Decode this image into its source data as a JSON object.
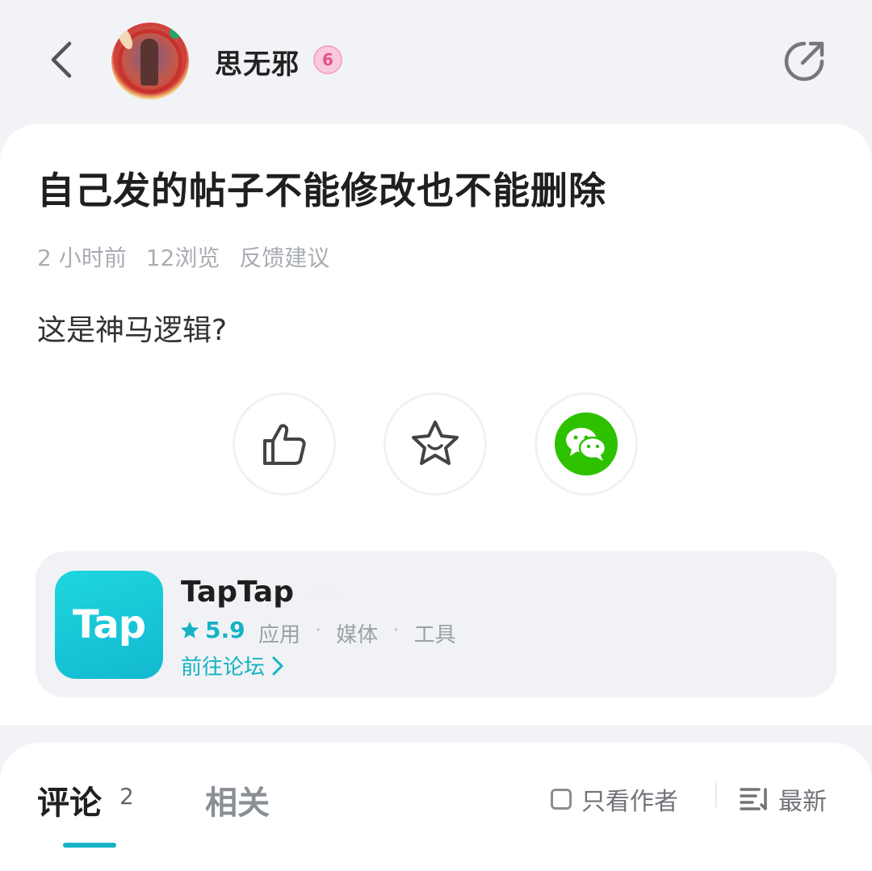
{
  "header": {
    "username": "思无邪",
    "level": "6"
  },
  "post": {
    "title": "自己发的帖子不能修改也不能删除",
    "time": "2 小时前",
    "views": "12浏览",
    "category": "反馈建议",
    "content": "这是神马逻辑?"
  },
  "app": {
    "icon_text": "Tap",
    "name": "TapTap",
    "tag": "应用",
    "rating": "5.9",
    "categories": [
      "应用",
      "媒体",
      "工具"
    ],
    "separator": "·",
    "forum_link": "前往论坛"
  },
  "tabs": {
    "comments_label": "评论",
    "comments_count": "2",
    "related_label": "相关",
    "author_only_label": "只看作者",
    "sort_label": "最新"
  },
  "colors": {
    "accent": "#15b3c3",
    "wechat": "#2dc100",
    "level_badge": "#f9c9dd"
  }
}
